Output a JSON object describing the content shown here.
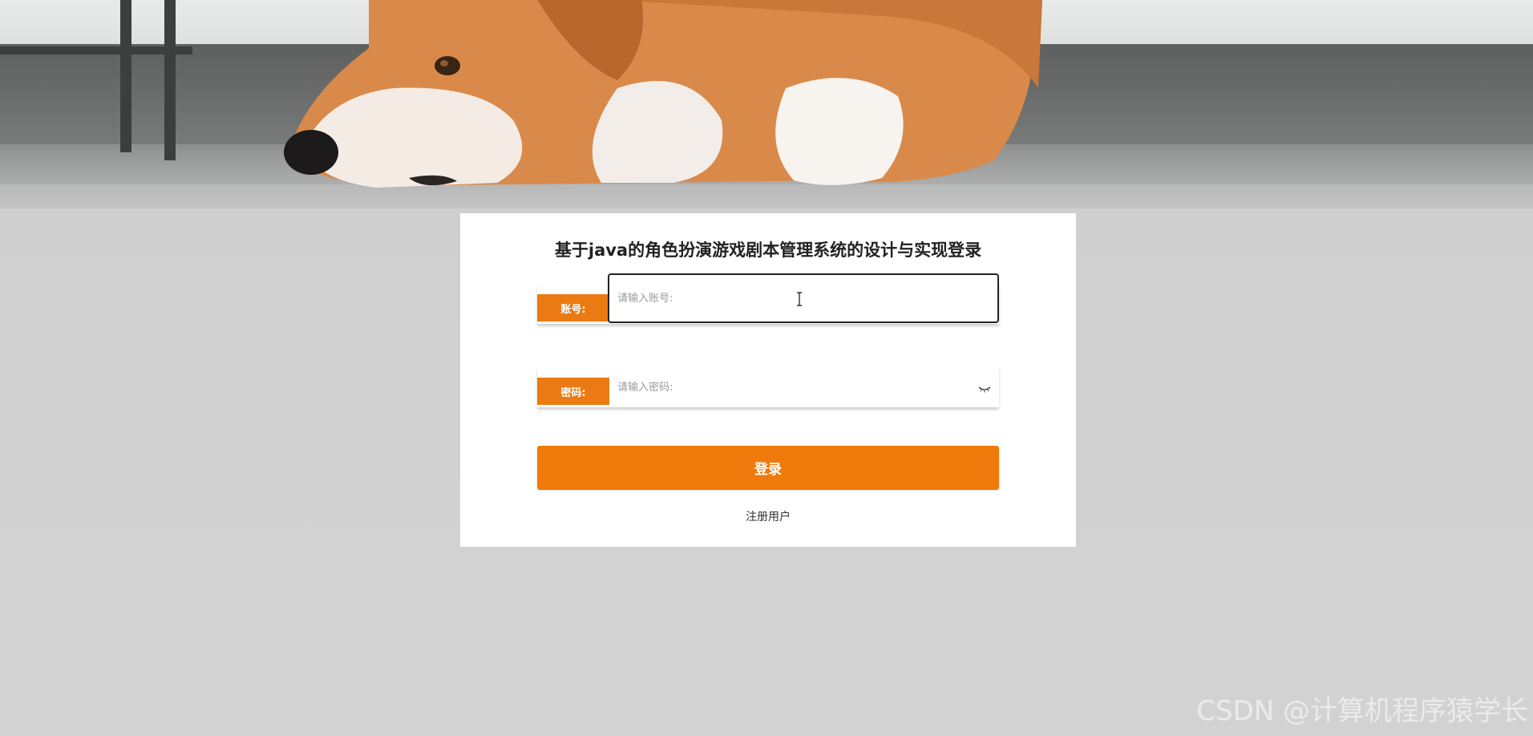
{
  "login": {
    "title": "基于java的角色扮演游戏剧本管理系统的设计与实现登录",
    "account_label": "账号:",
    "account_placeholder": "请输入账号:",
    "account_value": "",
    "password_label": "密码:",
    "password_placeholder": "请输入密码:",
    "password_value": "",
    "submit_label": "登录",
    "register_label": "注册用户"
  },
  "watermark": "CSDN @计算机程序猿学长",
  "colors": {
    "accent": "#f07b0c",
    "label_bg": "#ec7a12",
    "card_bg": "#ffffff",
    "title_text": "#222222"
  },
  "icons": {
    "password_toggle": "eye-closed-icon",
    "text_cursor": "text-cursor-icon"
  }
}
